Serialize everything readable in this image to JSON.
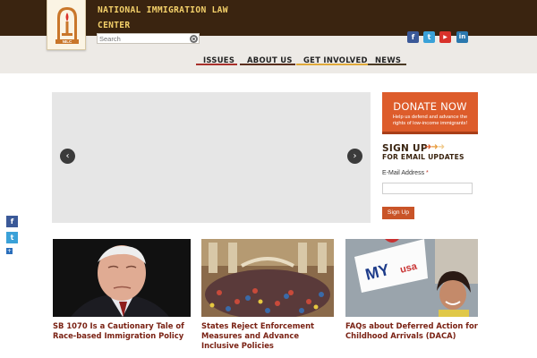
{
  "header": {
    "org_name": "NATIONAL IMMIGRATION LAW CENTER",
    "logo_text": "NILC",
    "search": {
      "placeholder": "Search"
    },
    "social": [
      {
        "name": "facebook",
        "glyph": "f",
        "color": "#3b5998"
      },
      {
        "name": "twitter",
        "glyph": "t",
        "color": "#3aa1d8"
      },
      {
        "name": "youtube",
        "glyph": "▶",
        "color": "#d9322b"
      },
      {
        "name": "linkedin",
        "glyph": "in",
        "color": "#2b78ae"
      }
    ]
  },
  "nav": {
    "items": [
      {
        "label": "ISSUES",
        "underline": "#a8302b"
      },
      {
        "label": "ABOUT US",
        "underline": "#5a2e1c"
      },
      {
        "label": "GET INVOLVED",
        "underline": "#e0a93a"
      },
      {
        "label": "NEWS",
        "underline": "#4a3a24"
      }
    ]
  },
  "carousel": {
    "prev_icon": "chevron-left-icon",
    "next_icon": "chevron-right-icon"
  },
  "sidebar": {
    "donate": {
      "title": "DONATE NOW",
      "subtitle": "Help us defend and advance the rights of low-income immigrants!"
    },
    "signup": {
      "heading": "SIGN UP",
      "subheading": "FOR EMAIL UPDATES",
      "email_label": "E-Mail Address",
      "required_mark": "*",
      "button_label": "Sign Up"
    }
  },
  "share_bar": [
    {
      "name": "facebook",
      "glyph": "f",
      "color": "#3b5998"
    },
    {
      "name": "twitter",
      "glyph": "t",
      "color": "#3aa1d8"
    },
    {
      "name": "more",
      "glyph": "+",
      "color": "#2a6ebb"
    }
  ],
  "stories": [
    {
      "title": "SB 1070 Is a Cautionary Tale of Race-based Immigration Policy"
    },
    {
      "title": "States Reject Enforcement Measures and Advance Inclusive Policies"
    },
    {
      "title": "FAQs about Deferred Action for Childhood Arrivals (DACA)"
    }
  ],
  "colors": {
    "header_bg": "#3a2410",
    "org_name": "#f3d06a",
    "accent": "#dd5c2b",
    "story_title": "#7a2214"
  }
}
